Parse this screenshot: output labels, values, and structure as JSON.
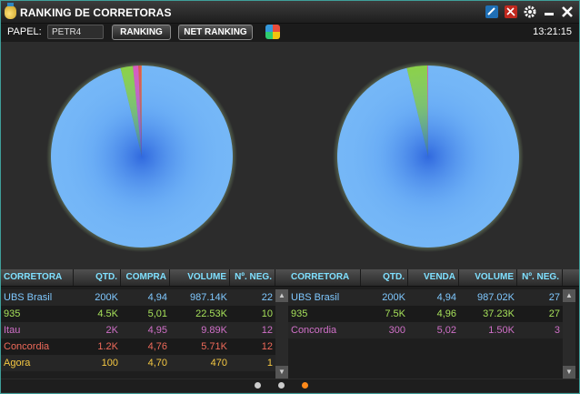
{
  "window": {
    "title": "RANKING DE CORRETORAS",
    "controls": [
      "link-icon",
      "unlink-icon",
      "gear-icon",
      "minimize-icon",
      "close-icon"
    ]
  },
  "toolbar": {
    "papel_label": "PAPEL:",
    "papel_value": "PETR4",
    "ranking_label": "RANKING",
    "net_ranking_label": "NET RANKING",
    "time": "13:21:15"
  },
  "colors": {
    "accent_border": "#3f9f9a",
    "header_text": "#7fe0ff",
    "pie_main": "#75b7f7",
    "pie_green": "#8bd149",
    "pie_pink": "#d75bbf",
    "pie_red": "#e2554b"
  },
  "chart_data": [
    {
      "type": "pie",
      "slices": [
        {
          "label": "UBS Brasil",
          "value": 987.14,
          "color": "#75b7f7"
        },
        {
          "label": "935",
          "value": 22.53,
          "color": "#8bd149"
        },
        {
          "label": "Itau",
          "value": 9.89,
          "color": "#d75bbf"
        },
        {
          "label": "Concordia",
          "value": 5.71,
          "color": "#e2554b"
        },
        {
          "label": "Agora",
          "value": 0.47,
          "color": "#f2c94c"
        }
      ]
    },
    {
      "type": "pie",
      "slices": [
        {
          "label": "UBS Brasil",
          "value": 987.02,
          "color": "#75b7f7"
        },
        {
          "label": "935",
          "value": 37.23,
          "color": "#8bd149"
        },
        {
          "label": "Concordia",
          "value": 1.5,
          "color": "#d75bbf"
        }
      ]
    }
  ],
  "buy_table": {
    "headers": [
      "CORRETORA",
      "QTD.",
      "COMPRA",
      "VOLUME",
      "Nº. NEG."
    ],
    "rows": [
      {
        "corretora": "UBS Brasil",
        "qtd": "200K",
        "preco": "4,94",
        "volume": "987.14K",
        "neg": "22",
        "color": "#7fc8ff"
      },
      {
        "corretora": "935",
        "qtd": "4.5K",
        "preco": "5,01",
        "volume": "22.53K",
        "neg": "10",
        "color": "#a6e05a"
      },
      {
        "corretora": "Itau",
        "qtd": "2K",
        "preco": "4,95",
        "volume": "9.89K",
        "neg": "12",
        "color": "#d070c8"
      },
      {
        "corretora": "Concordia",
        "qtd": "1.2K",
        "preco": "4,76",
        "volume": "5.71K",
        "neg": "12",
        "color": "#ef6a5a"
      },
      {
        "corretora": "Agora",
        "qtd": "100",
        "preco": "4,70",
        "volume": "470",
        "neg": "1",
        "color": "#f5c842"
      }
    ]
  },
  "sell_table": {
    "headers": [
      "CORRETORA",
      "QTD.",
      "VENDA",
      "VOLUME",
      "Nº. NEG."
    ],
    "rows": [
      {
        "corretora": "UBS Brasil",
        "qtd": "200K",
        "preco": "4,94",
        "volume": "987.02K",
        "neg": "27",
        "color": "#7fc8ff"
      },
      {
        "corretora": "935",
        "qtd": "7.5K",
        "preco": "4,96",
        "volume": "37.23K",
        "neg": "27",
        "color": "#a6e05a"
      },
      {
        "corretora": "Concordia",
        "qtd": "300",
        "preco": "5,02",
        "volume": "1.50K",
        "neg": "3",
        "color": "#d070c8"
      }
    ]
  },
  "pager": {
    "pages": 3,
    "current": 3
  }
}
